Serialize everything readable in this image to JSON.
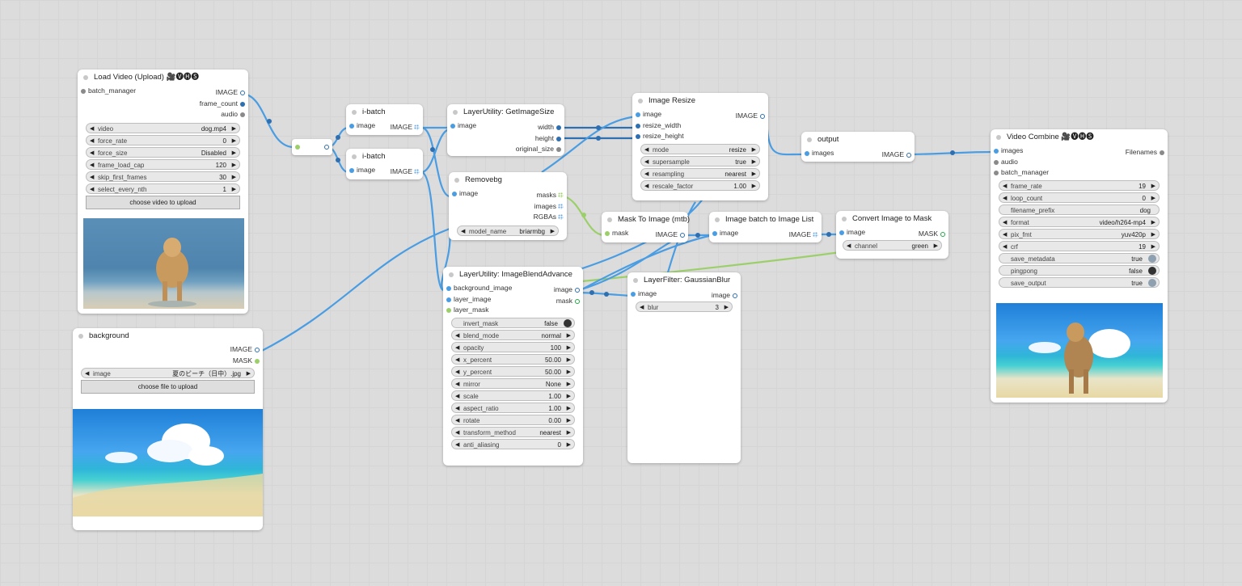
{
  "nodes": {
    "load_video": {
      "title": "Load Video (Upload) 🎥🅥🅗🅢",
      "input": "batch_manager",
      "outputs": [
        "IMAGE",
        "frame_count",
        "audio"
      ],
      "widgets": [
        {
          "label": "video",
          "value": "dog.mp4"
        },
        {
          "label": "force_rate",
          "value": "0"
        },
        {
          "label": "force_size",
          "value": "Disabled"
        },
        {
          "label": "frame_load_cap",
          "value": "120"
        },
        {
          "label": "skip_first_frames",
          "value": "30"
        },
        {
          "label": "select_every_nth",
          "value": "1"
        }
      ],
      "button": "choose video to upload"
    },
    "background": {
      "title": "background",
      "outputs": [
        "IMAGE",
        "MASK"
      ],
      "widgets": [
        {
          "label": "image",
          "value": "夏のビーチ（日中）.jpg"
        }
      ],
      "button": "choose file to upload"
    },
    "ibatch1": {
      "title": "i-batch",
      "input": "image",
      "output": "IMAGE"
    },
    "ibatch2": {
      "title": "i-batch",
      "input": "image",
      "output": "IMAGE"
    },
    "get_size": {
      "title": "LayerUtility: GetImageSize",
      "input": "image",
      "outputs": [
        "width",
        "height",
        "original_size"
      ]
    },
    "removebg": {
      "title": "Removebg",
      "input": "image",
      "outputs": [
        "masks",
        "images",
        "RGBAs"
      ],
      "widgets": [
        {
          "label": "model_name",
          "value": "briarmbg"
        }
      ]
    },
    "image_resize": {
      "title": "Image Resize",
      "inputs": [
        "image",
        "resize_width",
        "resize_height"
      ],
      "output": "IMAGE",
      "widgets": [
        {
          "label": "mode",
          "value": "resize"
        },
        {
          "label": "supersample",
          "value": "true"
        },
        {
          "label": "resampling",
          "value": "nearest"
        },
        {
          "label": "rescale_factor",
          "value": "1.00"
        }
      ]
    },
    "output": {
      "title": "output",
      "input": "images",
      "output": "IMAGE"
    },
    "mask_to_image": {
      "title": "Mask To Image (mtb)",
      "input": "mask",
      "output": "IMAGE"
    },
    "batch_to_list": {
      "title": "Image batch to Image List",
      "input": "image",
      "output": "IMAGE"
    },
    "convert_to_mask": {
      "title": "Convert Image to Mask",
      "input": "image",
      "output": "MASK",
      "widgets": [
        {
          "label": "channel",
          "value": "green"
        }
      ]
    },
    "blend_advance": {
      "title": "LayerUtility: ImageBlendAdvance",
      "inputs": [
        "background_image",
        "layer_image",
        "layer_mask"
      ],
      "outputs": [
        "image",
        "mask"
      ],
      "toggle": {
        "label": "invert_mask",
        "value": "false"
      },
      "widgets": [
        {
          "label": "blend_mode",
          "value": "normal"
        },
        {
          "label": "opacity",
          "value": "100"
        },
        {
          "label": "x_percent",
          "value": "50.00"
        },
        {
          "label": "y_percent",
          "value": "50.00"
        },
        {
          "label": "mirror",
          "value": "None"
        },
        {
          "label": "scale",
          "value": "1.00"
        },
        {
          "label": "aspect_ratio",
          "value": "1.00"
        },
        {
          "label": "rotate",
          "value": "0.00"
        },
        {
          "label": "transform_method",
          "value": "nearest"
        },
        {
          "label": "anti_aliasing",
          "value": "0"
        }
      ]
    },
    "gaussian_blur": {
      "title": "LayerFilter: GaussianBlur",
      "input": "image",
      "output": "image",
      "widgets": [
        {
          "label": "blur",
          "value": "3"
        }
      ]
    },
    "video_combine": {
      "title": "Video Combine 🎥🅥🅗🅢",
      "inputs": [
        "images",
        "audio",
        "batch_manager"
      ],
      "output": "Filenames",
      "widgets": [
        {
          "label": "frame_rate",
          "value": "19"
        },
        {
          "label": "loop_count",
          "value": "0"
        },
        {
          "label": "filename_prefix",
          "value": "dog"
        },
        {
          "label": "format",
          "value": "video/h264-mp4"
        },
        {
          "label": "pix_fmt",
          "value": "yuv420p"
        },
        {
          "label": "crf",
          "value": "19"
        }
      ],
      "toggles": [
        {
          "label": "save_metadata",
          "value": "true"
        },
        {
          "label": "pingpong",
          "value": "false"
        },
        {
          "label": "save_output",
          "value": "true"
        }
      ]
    }
  },
  "colors": {
    "image_link": "#4a9de2",
    "int_link": "#2d6fb0",
    "mask_link": "#9ccf6a",
    "canvas": "#dcdcdc"
  }
}
